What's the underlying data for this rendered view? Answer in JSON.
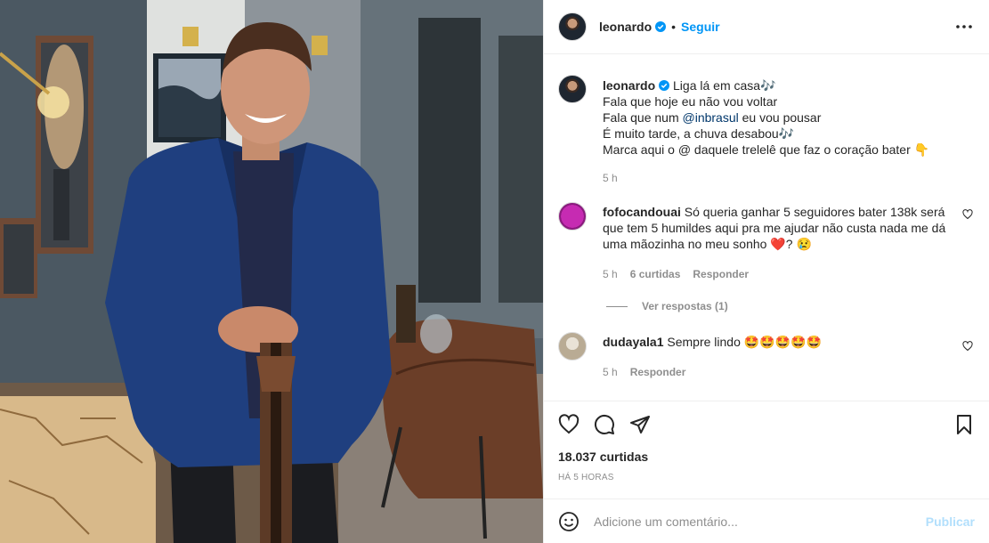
{
  "post": {
    "author": "leonardo",
    "follow_label": "Seguir",
    "separator": "•"
  },
  "caption": {
    "username": "leonardo",
    "lines": [
      "Liga lá em casa🎶",
      "Fala que hoje eu não vou voltar",
      "Fala que num ",
      "@inbrasul",
      " eu vou pousar",
      "É muito tarde, a chuva desabou🎶",
      "Marca aqui o @ daquele trelelê que faz o coração bater 👇"
    ],
    "time": "5 h"
  },
  "comments": [
    {
      "username": "fofocandouai",
      "text": "Só queria ganhar 5 seguidores bater 138k será que tem 5 humildes aqui pra me ajudar não custa nada me dá uma mãozinha no meu sonho ❤️? 😢",
      "time": "5 h",
      "likes": "6 curtidas",
      "reply": "Responder",
      "view_replies": "Ver respostas (1)"
    },
    {
      "username": "dudayala1",
      "text": "Sempre lindo 🤩🤩🤩🤩🤩",
      "time": "5 h",
      "reply": "Responder"
    }
  ],
  "footer": {
    "likes": "18.037 curtidas",
    "time": "HÁ 5 HORAS",
    "comment_placeholder": "Adicione um comentário...",
    "publish_label": "Publicar"
  },
  "icons": {
    "more": "more-icon",
    "like": "heart-icon",
    "comment": "comment-icon",
    "share": "share-icon",
    "save": "bookmark-icon",
    "emoji": "emoji-icon"
  },
  "colors": {
    "link": "#0095f6",
    "mention": "#00376b",
    "muted": "#8e8e8e",
    "verified": "#0095f6",
    "publish_disabled": "#b2dffc"
  }
}
